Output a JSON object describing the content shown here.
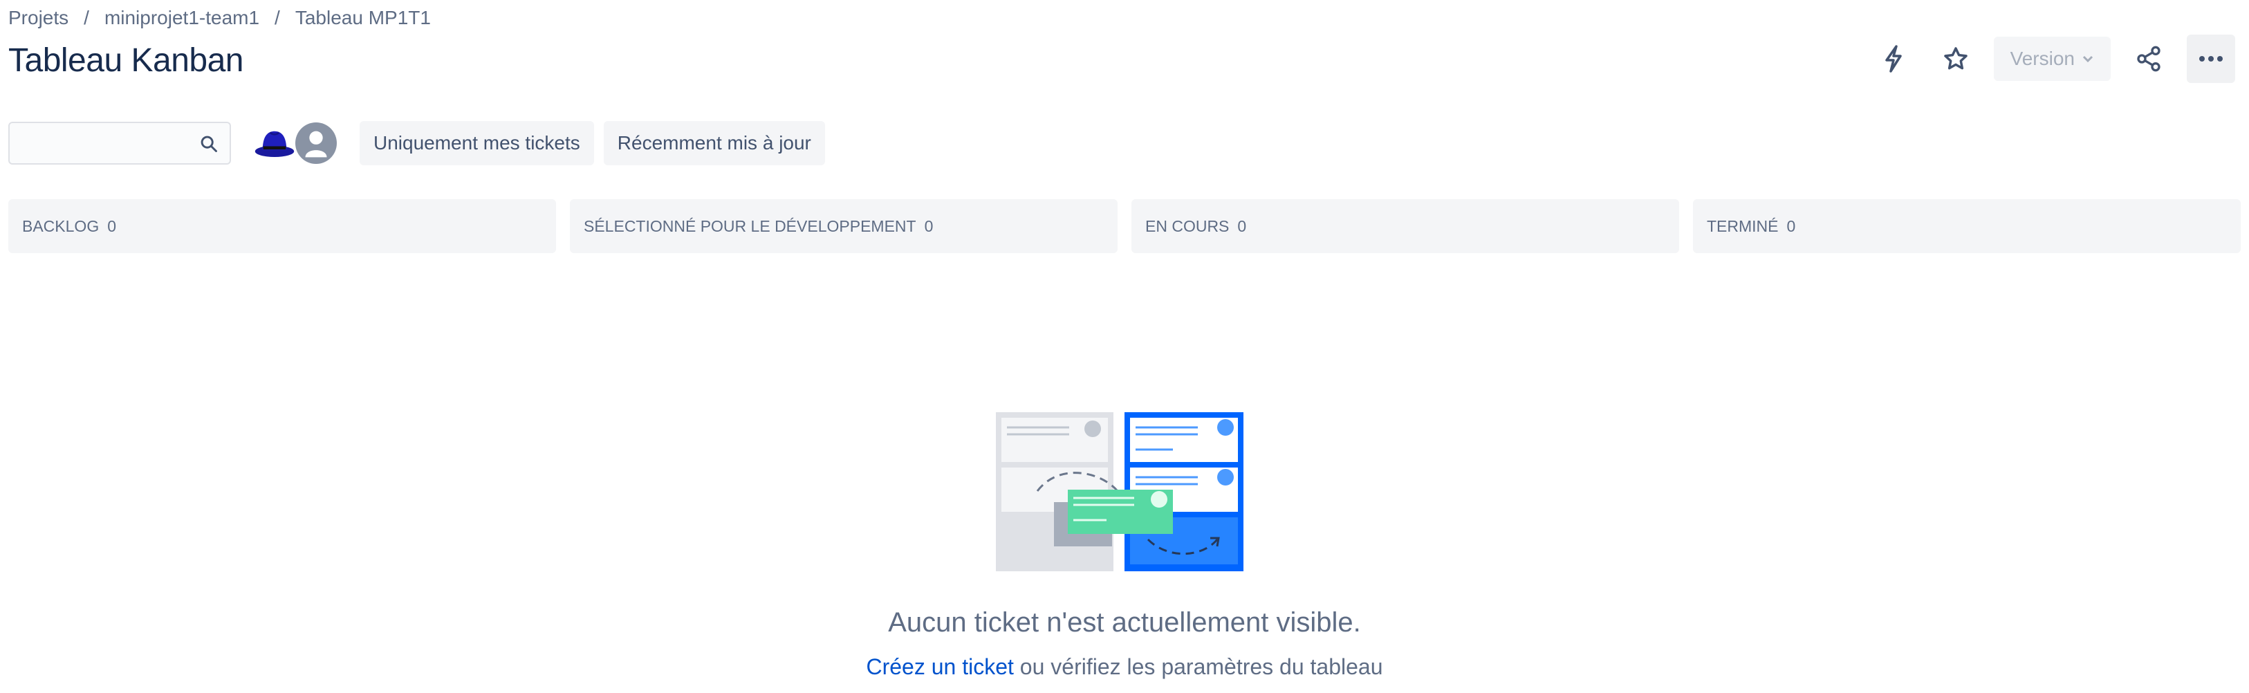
{
  "breadcrumb": {
    "items": [
      "Projets",
      "miniprojet1-team1",
      "Tableau MP1T1"
    ],
    "separator": "/"
  },
  "page": {
    "title": "Tableau Kanban"
  },
  "header_actions": {
    "version_label": "Version",
    "icons": [
      "lightning-icon",
      "star-icon",
      "share-icon",
      "more-icon"
    ]
  },
  "toolbar": {
    "search": {
      "value": "",
      "placeholder": ""
    },
    "filters": [
      "Uniquement mes tickets",
      "Récemment mis à jour"
    ]
  },
  "columns": [
    {
      "name": "BACKLOG",
      "count": "0"
    },
    {
      "name": "SÉLECTIONNÉ POUR LE DÉVELOPPEMENT",
      "count": "0"
    },
    {
      "name": "EN COURS",
      "count": "0"
    },
    {
      "name": "TERMINÉ",
      "count": "0"
    }
  ],
  "empty_state": {
    "title": "Aucun ticket n'est actuellement visible.",
    "link": "Créez un ticket",
    "suffix": " ou vérifiez les paramètres du tableau"
  },
  "colors": {
    "primary_text": "#172b4d",
    "secondary_text": "#5e6c84",
    "link": "#0052cc",
    "column_bg": "#f4f5f7",
    "illustration_blue": "#0065ff",
    "illustration_green": "#57d9a3"
  }
}
